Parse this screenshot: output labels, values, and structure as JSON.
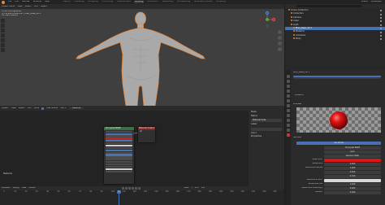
{
  "topbar": {
    "menus": [
      "File",
      "Edit",
      "Render",
      "Window",
      "Help"
    ],
    "tabs": [
      "Layout",
      "Modeling",
      "Sculpting",
      "UV Editing",
      "Texture Paint",
      "Shading",
      "Animation",
      "Rendering",
      "Compositing",
      "Geometry Nodes",
      "Scripting"
    ],
    "active_tab": "Shading",
    "scene": "Scene",
    "view_layer": "ViewLayer"
  },
  "viewport": {
    "header": [
      "Object Mode",
      "View",
      "Select",
      "Add",
      "Object"
    ],
    "info_lines": [
      "Front Orthographic",
      "(1) Scene Collection | Man_base_v2.1",
      "10 Centimeters"
    ],
    "gizmo": {
      "x": "X",
      "y": "Y",
      "z": "Z"
    }
  },
  "node_editor": {
    "header": [
      "Object",
      "View",
      "Select",
      "Add",
      "Node"
    ],
    "use_nodes_label": "Use Nodes",
    "slot": "Slot 1",
    "material": "Material",
    "bsdf_title": "Principled BSDF",
    "output_title": "Material Output",
    "output_label": "All",
    "sidebar": {
      "node_label": "Node",
      "name_label": "Name:",
      "name_value": "Material Outp",
      "label_label": "Label:",
      "color_label": "Color",
      "properties_label": "Properties"
    },
    "footer_label": "Material"
  },
  "timeline": {
    "header": [
      "Playback",
      "Keying",
      "View",
      "Marker"
    ],
    "frames": [
      "0",
      "10",
      "20",
      "30",
      "40",
      "50",
      "60",
      "70",
      "80",
      "90",
      "100",
      "110",
      "120",
      "130",
      "140",
      "150",
      "160",
      "170",
      "180",
      "190",
      "200",
      "210",
      "220",
      "230",
      "240",
      "250"
    ],
    "current_frame": "1",
    "start_label": "Start",
    "start": "1",
    "end_label": "End",
    "end": "250"
  },
  "outliner": {
    "rows": [
      {
        "label": "Scene Collection",
        "selected": false
      },
      {
        "label": "Collection",
        "selected": false
      },
      {
        "label": "Camera",
        "selected": false
      },
      {
        "label": "Cube",
        "selected": false
      },
      {
        "label": "Light",
        "selected": false
      },
      {
        "label": "Man_base_v2.1",
        "selected": true
      },
      {
        "label": "Material",
        "selected": false
      },
      {
        "label": "Armature",
        "selected": false
      },
      {
        "label": "Body",
        "selected": false
      }
    ]
  },
  "properties": {
    "object_name": "Man_base_v2.1",
    "material_name": "Material",
    "preview_label": "Preview",
    "surface_label": "Surface",
    "use_nodes": "Use Nodes",
    "surface_value": "Principled BSDF",
    "distribution": "GGX",
    "subsurface_method": "Random Walk",
    "fields": [
      {
        "label": "Base Color",
        "value": ""
      },
      {
        "label": "Subsurface",
        "value": "0.000"
      },
      {
        "label": "Subsurface Radius",
        "value": "1.000"
      },
      {
        "label": "",
        "value": "0.200"
      },
      {
        "label": "",
        "value": "0.100"
      },
      {
        "label": "Subsurface Color",
        "value": ""
      },
      {
        "label": "Subsurface IOR",
        "value": "1.400"
      },
      {
        "label": "Subsurface Anisotropy",
        "value": "0.000"
      },
      {
        "label": "Metallic",
        "value": "0.000"
      }
    ],
    "colors": {
      "base_color": "#e01414",
      "subsurface_color": "#d8d8d8",
      "accent": "#4772b3"
    }
  }
}
